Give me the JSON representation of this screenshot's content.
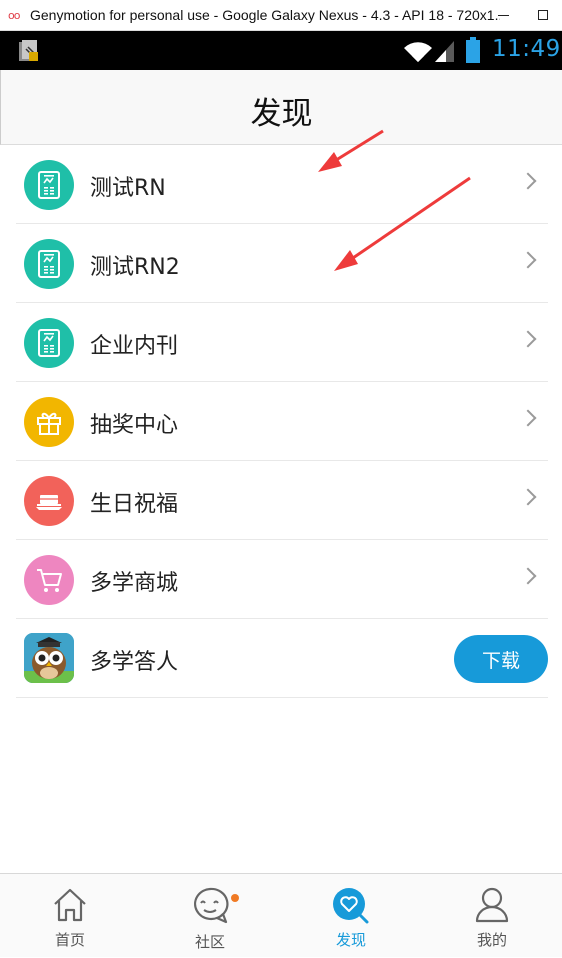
{
  "window": {
    "title": "Genymotion for personal use - Google Galaxy Nexus - 4.3 - API 18 - 720x1...",
    "logo": "oo"
  },
  "statusbar": {
    "time": "11:49",
    "time_color": "#2ba3e6"
  },
  "header": {
    "title": "发现"
  },
  "list": {
    "items": [
      {
        "label": "测试RN",
        "icon": "document-chart-icon",
        "color": "#1fbfa8"
      },
      {
        "label": "测试RN2",
        "icon": "document-chart-icon",
        "color": "#1fbfa8"
      },
      {
        "label": "企业内刊",
        "icon": "document-chart-icon",
        "color": "#1fbfa8"
      },
      {
        "label": "抽奖中心",
        "icon": "gift-icon",
        "color": "#f2b600"
      },
      {
        "label": "生日祝福",
        "icon": "cake-icon",
        "color": "#f2625a"
      },
      {
        "label": "多学商城",
        "icon": "cart-icon",
        "color": "#ee86c0"
      },
      {
        "label": "多学答人",
        "icon": "owl-app-icon",
        "button": "下载"
      }
    ]
  },
  "tabbar": {
    "tabs": [
      {
        "label": "首页",
        "icon": "home-icon"
      },
      {
        "label": "社区",
        "icon": "chat-face-icon"
      },
      {
        "label": "发现",
        "icon": "discover-heart-icon",
        "active": true
      },
      {
        "label": "我的",
        "icon": "person-icon"
      }
    ],
    "accent": "#179ad9"
  }
}
